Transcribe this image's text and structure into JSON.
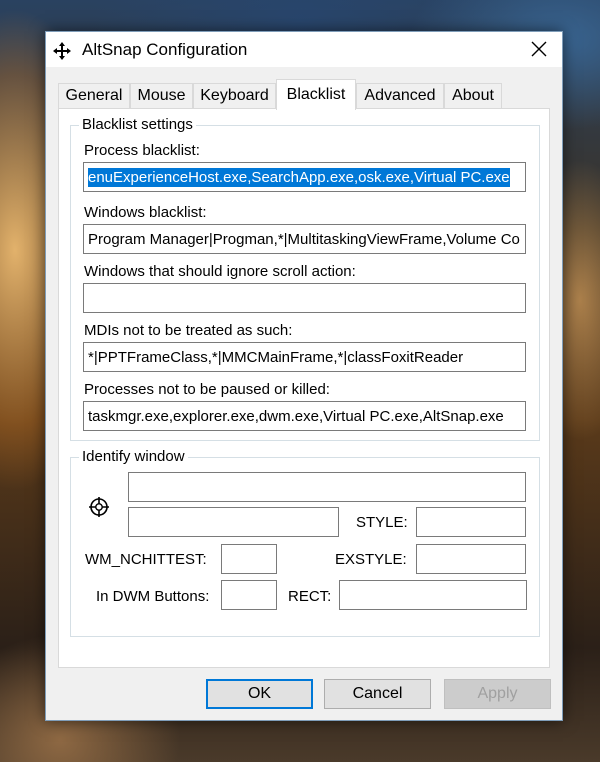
{
  "window": {
    "title": "AltSnap Configuration"
  },
  "tabs": [
    {
      "label": "General"
    },
    {
      "label": "Mouse"
    },
    {
      "label": "Keyboard"
    },
    {
      "label": "Blacklist",
      "active": true
    },
    {
      "label": "Advanced"
    },
    {
      "label": "About"
    }
  ],
  "blacklist_settings": {
    "title": "Blacklist settings",
    "process_blacklist": {
      "label": "Process blacklist:",
      "value": "enuExperienceHost.exe,SearchApp.exe,osk.exe,Virtual PC.exe"
    },
    "windows_blacklist": {
      "label": "Windows blacklist:",
      "value": "Program Manager|Progman,*|MultitaskingViewFrame,Volume Co"
    },
    "ignore_scroll": {
      "label": "Windows that should ignore scroll action:",
      "value": ""
    },
    "mdis": {
      "label": "MDIs not to be treated as such:",
      "value": "*|PPTFrameClass,*|MMCMainFrame,*|classFoxitReader"
    },
    "not_paused": {
      "label": "Processes not to be paused or killed:",
      "value": "taskmgr.exe,explorer.exe,dwm.exe,Virtual PC.exe,AltSnap.exe"
    }
  },
  "identify_window": {
    "title": "Identify window",
    "style_label": "STYLE:",
    "wm_nchittest_label": "WM_NCHITTEST:",
    "exstyle_label": "EXSTYLE:",
    "dwm_buttons_label": "In DWM Buttons:",
    "rect_label": "RECT:"
  },
  "buttons": {
    "ok": "OK",
    "cancel": "Cancel",
    "apply": "Apply"
  }
}
